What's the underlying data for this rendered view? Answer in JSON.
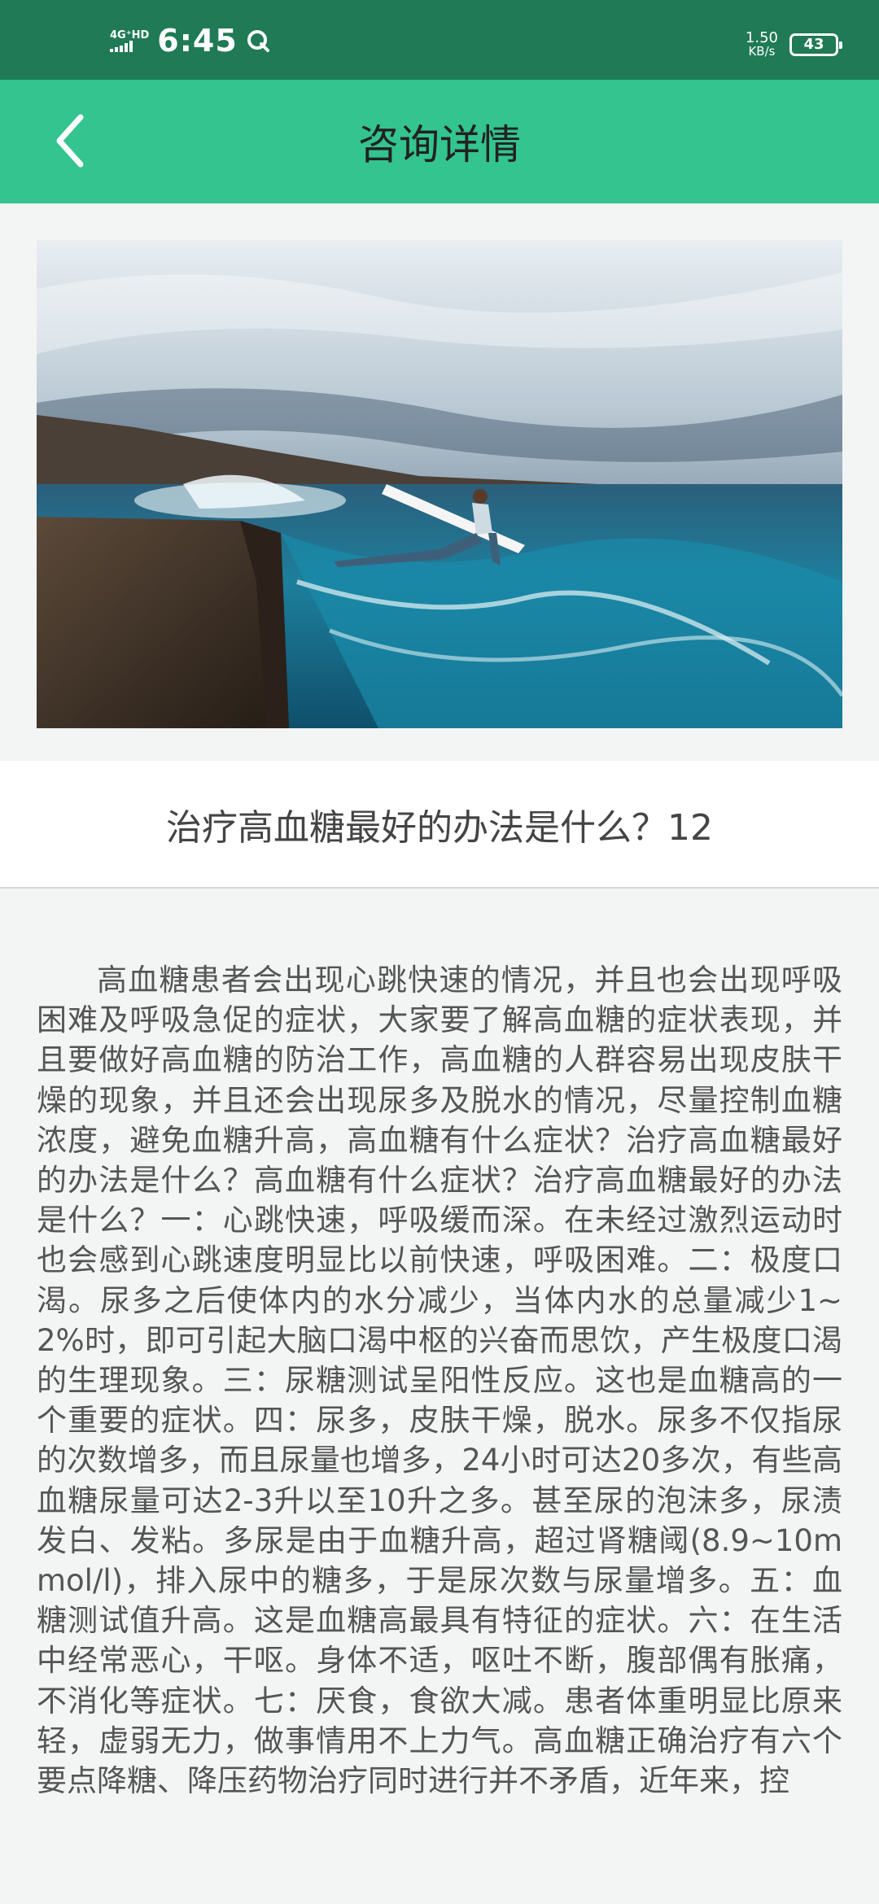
{
  "status_bar": {
    "network": "4G⁺HD",
    "time": "6:45",
    "speed_value": "1.50",
    "speed_unit": "KB/s",
    "battery": "43"
  },
  "header": {
    "title": "咨询详情",
    "back_icon": "chevron-left-icon"
  },
  "hero_image": {
    "description": "surfer-leaping-off-cliff-photo"
  },
  "article": {
    "title": "治疗高血糖最好的办法是什么？12",
    "body": "高血糖患者会出现心跳快速的情况，并且也会出现呼吸困难及呼吸急促的症状，大家要了解高血糖的症状表现，并且要做好高血糖的防治工作，高血糖的人群容易出现皮肤干燥的现象，并且还会出现尿多及脱水的情况，尽量控制血糖浓度，避免血糖升高，高血糖有什么症状？治疗高血糖最好的办法是什么？高血糖有什么症状？治疗高血糖最好的办法是什么？一：心跳快速，呼吸缓而深。在未经过激烈运动时也会感到心跳速度明显比以前快速，呼吸困难。二：极度口渴。尿多之后使体内的水分减少，当体内水的总量减少1~2%时，即可引起大脑口渴中枢的兴奋而思饮，产生极度口渴的生理现象。三：尿糖测试呈阳性反应。这也是血糖高的一个重要的症状。四：尿多，皮肤干燥，脱水。尿多不仅指尿的次数增多，而且尿量也增多，24小时可达20多次，有些高血糖尿量可达2-3升以至10升之多。甚至尿的泡沫多，尿渍发白、发粘。多尿是由于血糖升高，超过肾糖阈(8.9~10mmol/l)，排入尿中的糖多，于是尿次数与尿量增多。五：血糖测试值升高。这是血糖高最具有特征的症状。六：在生活中经常恶心，干呕。身体不适，呕吐不断，腹部偶有胀痛，不消化等症状。七：厌食，食欲大减。患者体重明显比原来轻，虚弱无力，做事情用不上力气。高血糖正确治疗有六个要点降糖、降压药物治疗同时进行并不矛盾，近年来，控"
  },
  "colors": {
    "status_bar": "#1f7a55",
    "header": "#33c48f",
    "page_bg": "#f3f5f4",
    "body_text": "#555555"
  }
}
